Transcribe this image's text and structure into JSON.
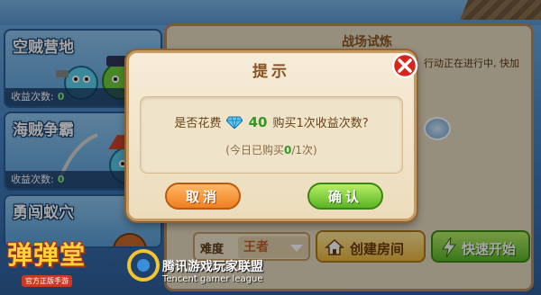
{
  "modes": [
    {
      "title": "空贼营地",
      "count_label": "收益次数:",
      "count": "0"
    },
    {
      "title": "海贼争霸",
      "count_label": "收益次数:",
      "count": "0"
    },
    {
      "title": "勇闯蚁穴",
      "count_label": "",
      "count": ""
    }
  ],
  "panel": {
    "header": "战场试炼",
    "hint": "行动正在进行中, 快加"
  },
  "bottom": {
    "difficulty_label": "难度",
    "difficulty_value": "王者",
    "create_room": "创建房间",
    "quick_start": "快速开始"
  },
  "dialog": {
    "title": "提示",
    "question_prefix": "是否花费",
    "gem_amount": "40",
    "question_suffix": "购买1次收益次数?",
    "sub_prefix": "(今日已购买",
    "sub_used": "0",
    "sub_suffix": "/1次)",
    "cancel": "取消",
    "confirm": "确认"
  },
  "branding": {
    "game_logo": "弹弹堂",
    "game_logo_sub": "官方正版手游",
    "tencent_cn": "腾讯游戏玩家联盟",
    "tencent_en": "Tencent gamer league"
  },
  "icons": {
    "close": "close-x-icon",
    "gem": "diamond-gem-icon",
    "home": "home-icon",
    "bolt": "lightning-bolt-icon",
    "shield": "shield-icon"
  },
  "colors": {
    "accent_green": "#2e9b1f",
    "cancel_orange": "#ef7f20",
    "confirm_green": "#5cb326",
    "close_red": "#d8251c"
  }
}
